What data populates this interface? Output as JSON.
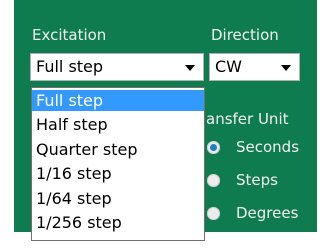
{
  "excitation": {
    "heading": "Excitation",
    "selected": "Full step",
    "options": [
      "Full step",
      "Half step",
      "Quarter step",
      "1/16 step",
      "1/64 step",
      "1/256 step"
    ],
    "highlighted_option": "Full step"
  },
  "direction": {
    "heading": "Direction",
    "selected": "CW"
  },
  "transfer_unit": {
    "heading_visible": "ansfer Unit",
    "options": [
      {
        "label": "Seconds",
        "checked": true
      },
      {
        "label": "Steps",
        "checked": false
      },
      {
        "label": "Degrees",
        "checked": false
      }
    ]
  },
  "colors": {
    "panel": "#0f7c4f",
    "selection": "#3399ff",
    "radio_dot": "#1c7fc9"
  }
}
